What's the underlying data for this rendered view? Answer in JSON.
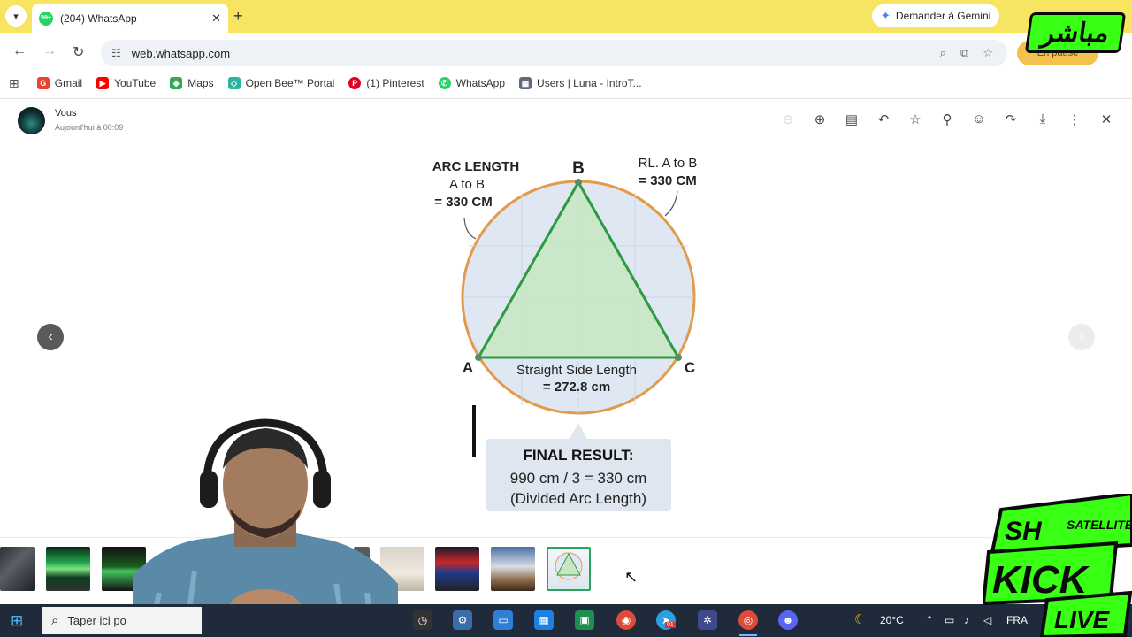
{
  "browser": {
    "tab_title": "(204) WhatsApp",
    "tab_badge": "99+",
    "tab_close": "✕",
    "new_tab": "+",
    "gemini_label": "Demander à Gemini",
    "url": "web.whatsapp.com",
    "profile_status": "En pause"
  },
  "bookmarks": [
    {
      "label": "Gmail",
      "color": "#ea4335",
      "icon": "G"
    },
    {
      "label": "YouTube",
      "color": "#ff0000",
      "icon": "▶"
    },
    {
      "label": "Maps",
      "color": "#34a853",
      "icon": "◆"
    },
    {
      "label": "Open Bee™ Portal",
      "color": "#2bb5a0",
      "icon": "◇"
    },
    {
      "label": "(1) Pinterest",
      "color": "#e60023",
      "icon": "P"
    },
    {
      "label": "WhatsApp",
      "color": "#25d366",
      "icon": "✆"
    },
    {
      "label": "Users | Luna - IntroT...",
      "color": "#5f6b7a",
      "icon": "▦"
    }
  ],
  "viewer": {
    "sender": "Vous",
    "timestamp": "Aujourd'hui à 00:09",
    "prev": "‹",
    "next": "›"
  },
  "image": {
    "arc_title": "ARC LENGTH",
    "arc_sub": "A to B",
    "arc_value": "= 330 CM",
    "rl_title": "RL. A to B",
    "rl_value": "= 330 CM",
    "vertex_a": "A",
    "vertex_b": "B",
    "vertex_c": "C",
    "side_title": "Straight Side Length",
    "side_value": "= 272.8 cm",
    "result_title": "FINAL RESULT:",
    "result_line1": "990 cm / 3 = 330 cm",
    "result_line2": "(Divided Arc Length)"
  },
  "taskbar": {
    "search_placeholder": "Taper ici po",
    "weather": "20°C",
    "language": "FRA",
    "badge": "01"
  },
  "overlay": {
    "logo_top": "مباشر",
    "logo_sh": "SH",
    "logo_satellite": "SATELLITE",
    "logo_kick": "KICK",
    "logo_live": "LIVE"
  }
}
